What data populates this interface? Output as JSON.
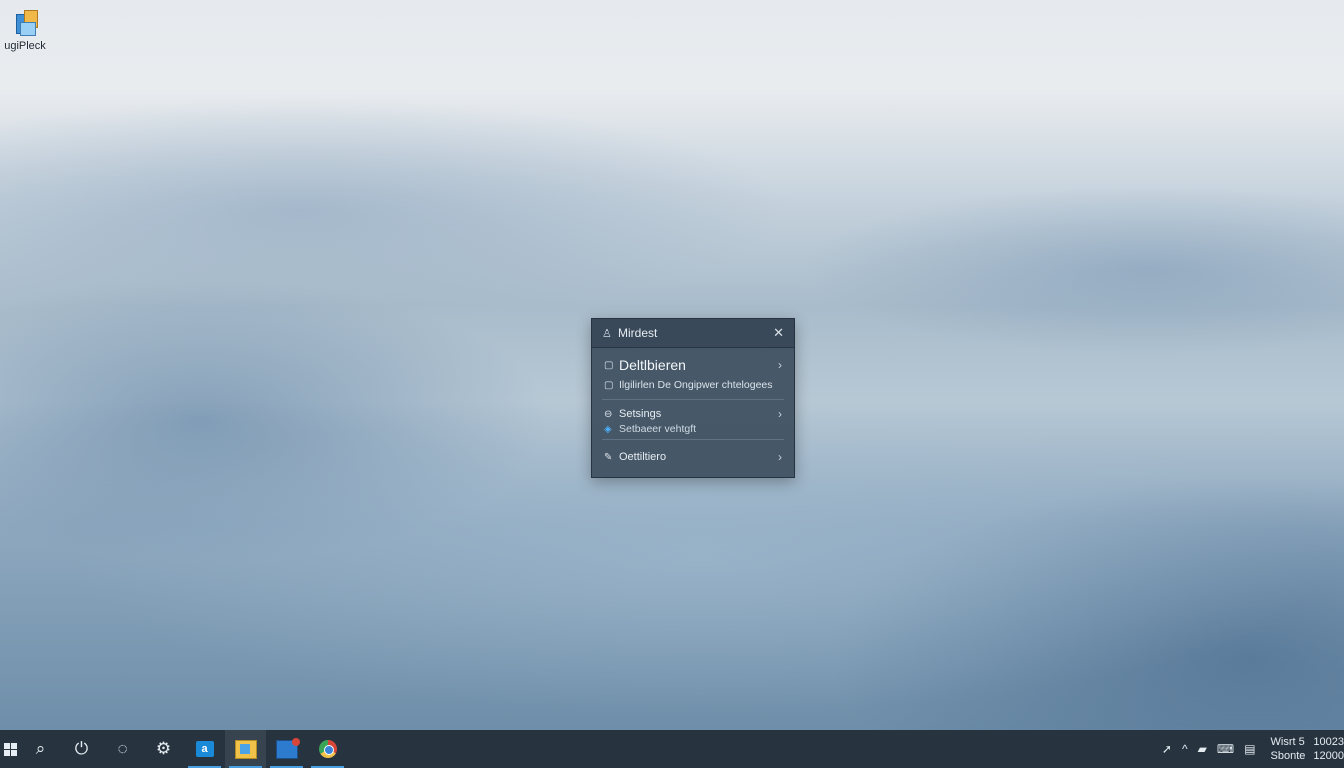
{
  "desktop": {
    "icons": [
      {
        "label": "ugiPleck",
        "icon": "app-shortcut-icon"
      }
    ]
  },
  "popup": {
    "title": "Mirdest",
    "close_glyph": "✕",
    "main_item": {
      "label": "Deltlbieren",
      "icon": "page-icon"
    },
    "sub_item": {
      "label": "Ilgilirlen De Ongipwer chtelogees",
      "icon": "page-icon"
    },
    "settings_item": {
      "label": "Setsings",
      "icon": "settings-icon"
    },
    "settings_sub": {
      "label": "Setbaeer vehtgft",
      "icon": "shield-icon"
    },
    "last_item": {
      "label": "Oettiltiero",
      "icon": "pin-icon"
    },
    "chevron": "›"
  },
  "taskbar": {
    "apps": [
      {
        "name": "start",
        "icon": "windows-start-icon"
      },
      {
        "name": "search",
        "icon": "search-icon"
      },
      {
        "name": "power",
        "icon": "power-icon"
      },
      {
        "name": "timer",
        "icon": "clock-icon"
      },
      {
        "name": "settings",
        "icon": "gear-icon"
      },
      {
        "name": "store",
        "icon": "store-icon"
      },
      {
        "name": "explorer",
        "icon": "file-explorer-icon"
      },
      {
        "name": "remote",
        "icon": "remote-desktop-icon"
      },
      {
        "name": "browser",
        "icon": "browser-icon"
      }
    ],
    "tray": {
      "icons": [
        "pen-icon",
        "chevron-up-icon",
        "battery-icon",
        "keyboard-icon",
        "display-icon"
      ],
      "clock_line1_a": "Wisrt 5",
      "clock_line2_a": "Sbonte",
      "clock_line1_b": "10023",
      "clock_line2_b": "12000"
    }
  },
  "colors": {
    "taskbar": "#27343f",
    "popup": "#3e5060",
    "accent": "#4a9fe0"
  }
}
